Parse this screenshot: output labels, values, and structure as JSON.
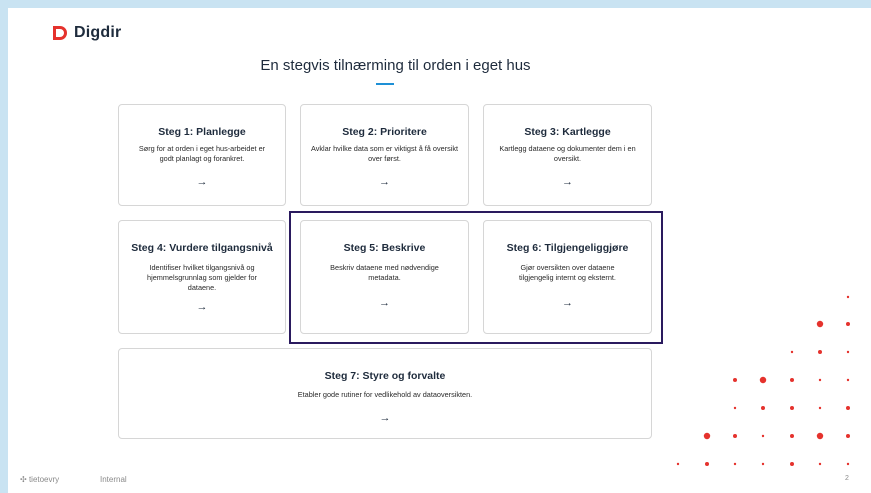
{
  "brand": {
    "name": "Digdir",
    "color": "#e5322d"
  },
  "slide": {
    "title": "En stegvis tilnærming til orden i eget hus",
    "accent": "#1e90d6"
  },
  "steps": [
    {
      "title": "Steg 1: Planlegge",
      "desc": "Sørg for at orden i eget hus-arbeidet er godt planlagt og forankret.",
      "arrow": "→"
    },
    {
      "title": "Steg 2: Prioritere",
      "desc": "Avklar hvilke data som er viktigst å få oversikt over først.",
      "arrow": "→"
    },
    {
      "title": "Steg 3: Kartlegge",
      "desc": "Kartlegg dataene og dokumenter dem i en oversikt.",
      "arrow": "→"
    },
    {
      "title": "Steg 4: Vurdere tilgangsnivå",
      "desc": "Identifiser hvilket tilgangsnivå og hjemmelsgrunnlag som gjelder for dataene.",
      "arrow": "→"
    },
    {
      "title": "Steg 5: Beskrive",
      "desc": "Beskriv dataene med nødvendige metadata.",
      "arrow": "→"
    },
    {
      "title": "Steg 6: Tilgjengeliggjøre",
      "desc": "Gjør oversikten over dataene tilgjengelig internt og eksternt.",
      "arrow": "→"
    },
    {
      "title": "Steg 7: Styre og forvalte",
      "desc": "Etabler gode rutiner for vedlikehold av dataoversikten.",
      "arrow": "→"
    }
  ],
  "highlight_color": "#2a1a5e",
  "footer": {
    "logo_text": "tietoevry",
    "classification": "Internal",
    "page_number": "2"
  },
  "decoration": {
    "dot_color": "#e5322d"
  }
}
